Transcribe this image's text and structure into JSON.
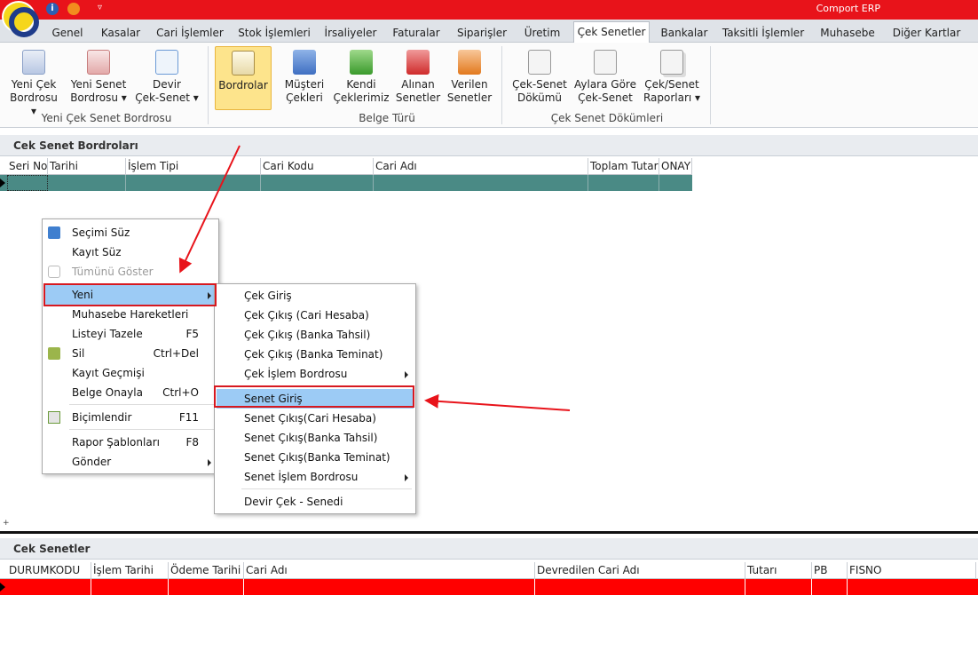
{
  "app": {
    "title": "Comport ERP"
  },
  "tabs": [
    "Genel",
    "Kasalar",
    "Cari İşlemler",
    "Stok İşlemleri",
    "İrsaliyeler",
    "Faturalar",
    "Siparişler",
    "Üretim",
    "Çek Senetler",
    "Bankalar",
    "Taksitli İşlemler",
    "Muhasebe",
    "Diğer Kartlar"
  ],
  "active_tab": "Çek Senetler",
  "ribbon": {
    "buttons": [
      {
        "l1": "Yeni Çek",
        "l2": "Bordrosu ▾",
        "icon": "document-add-icon"
      },
      {
        "l1": "Yeni Senet",
        "l2": "Bordrosu ▾",
        "icon": "document-add-red-icon"
      },
      {
        "l1": "Devir",
        "l2": "Çek-Senet ▾",
        "icon": "currency-refresh-icon"
      },
      {
        "l1": "Bordrolar",
        "l2": "",
        "icon": "edit-document-icon"
      },
      {
        "l1": "Müşteri",
        "l2": "Çekleri",
        "icon": "blue-folder-icon"
      },
      {
        "l1": "Kendi",
        "l2": "Çeklerimiz",
        "icon": "green-folder-icon"
      },
      {
        "l1": "Alınan",
        "l2": "Senetler",
        "icon": "red-folder-icon"
      },
      {
        "l1": "Verilen",
        "l2": "Senetler",
        "icon": "orange-folder-icon"
      },
      {
        "l1": "Çek-Senet",
        "l2": "Dökümü",
        "icon": "report-icon"
      },
      {
        "l1": "Aylara Göre",
        "l2": "Çek-Senet",
        "icon": "report-icon"
      },
      {
        "l1": "Çek/Senet",
        "l2": "Raporları ▾",
        "icon": "reports-stack-icon"
      }
    ],
    "groups": [
      "Yeni Çek Senet Bordrosu",
      "Belge Türü",
      "Çek Senet Dökümleri"
    ]
  },
  "top_panel": {
    "title": "Cek Senet Bordroları",
    "columns": [
      "Seri No",
      "Tarihi",
      "İşlem Tipi",
      "Cari Kodu",
      "Cari Adı",
      "Toplam Tutar",
      "ONAY"
    ]
  },
  "bottom_panel": {
    "title": "Cek Senetler",
    "columns": [
      "DURUMKODU",
      "İşlem Tarihi",
      "Ödeme Tarihi",
      "Cari Adı",
      "Devredilen Cari Adı",
      "Tutarı",
      "PB",
      "FISNO"
    ]
  },
  "context_menu": [
    {
      "label": "Seçimi Süz",
      "shortcut": "",
      "icon": "filter-selection-icon"
    },
    {
      "label": "Kayıt Süz",
      "shortcut": ""
    },
    {
      "label": "Tümünü Göster",
      "shortcut": "",
      "disabled": true,
      "icon": "show-all-icon"
    },
    {
      "label": "Yeni",
      "shortcut": "",
      "submenu": true
    },
    {
      "label": "Muhasebe Hareketleri",
      "shortcut": ""
    },
    {
      "label": "Listeyi Tazele",
      "shortcut": "F5"
    },
    {
      "label": "Sil",
      "shortcut": "Ctrl+Del",
      "icon": "delete-icon"
    },
    {
      "label": "Kayıt Geçmişi",
      "shortcut": ""
    },
    {
      "label": "Belge Onayla",
      "shortcut": "Ctrl+O"
    },
    {
      "label": "Biçimlendir",
      "shortcut": "F11",
      "icon": "format-grid-icon"
    },
    {
      "label": "Rapor Şablonları",
      "shortcut": "F8"
    },
    {
      "label": "Gönder",
      "shortcut": "",
      "submenu": true
    }
  ],
  "submenu": [
    {
      "label": "Çek Giriş"
    },
    {
      "label": "Çek Çıkış (Cari Hesaba)"
    },
    {
      "label": "Çek Çıkış (Banka Tahsil)"
    },
    {
      "label": "Çek Çıkış (Banka Teminat)"
    },
    {
      "label": "Çek İşlem Bordrosu",
      "submenu": true
    },
    {
      "label": "Senet Giriş"
    },
    {
      "label": "Senet Çıkış(Cari Hesaba)"
    },
    {
      "label": "Senet Çıkış(Banka Tahsil)"
    },
    {
      "label": "Senet Çıkış(Banka Teminat)"
    },
    {
      "label": "Senet İşlem Bordrosu",
      "submenu": true
    },
    {
      "label": "Devir Çek - Senedi"
    }
  ],
  "colors": {
    "titlebar": "#e8131a",
    "grid_row_top": "#4a8a85",
    "grid_row_bottom": "#ff0000",
    "highlight": "#9ccbf5",
    "annotation": "#d71920"
  }
}
